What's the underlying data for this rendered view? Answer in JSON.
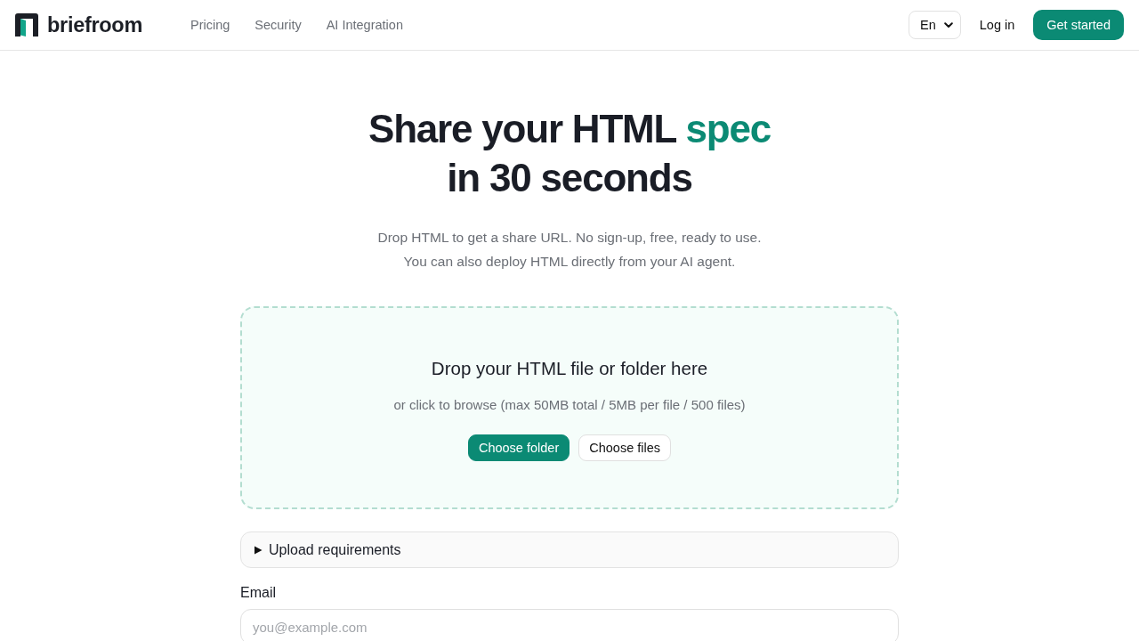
{
  "header": {
    "logo": {
      "text": "briefroom"
    },
    "nav": [
      {
        "label": "Pricing"
      },
      {
        "label": "Security"
      },
      {
        "label": "AI Integration"
      }
    ],
    "language": {
      "value": "En"
    },
    "login": "Log in",
    "cta": "Get started"
  },
  "hero": {
    "headline": [
      [
        {
          "text": "Share your HTML",
          "highlight": false
        },
        {
          "text": "spec",
          "highlight": true
        }
      ],
      [
        {
          "text": "in 30 seconds",
          "highlight": false
        }
      ]
    ],
    "subtitle": [
      "Drop HTML to get a share URL. No sign-up, free, ready to use.",
      "You can also deploy HTML directly from your AI agent."
    ]
  },
  "dropzone": {
    "title": "Drop your HTML file or folder here",
    "hint": "or click to browse (max 50MB total / 5MB per file / 500 files)",
    "buttons": [
      {
        "label": "Choose folder",
        "kind": "primary"
      },
      {
        "label": "Choose files",
        "kind": "secondary"
      }
    ]
  },
  "requirements": {
    "label": "Upload requirements",
    "expanded": false
  },
  "email": {
    "label": "Email",
    "placeholder": "you@example.com"
  }
}
